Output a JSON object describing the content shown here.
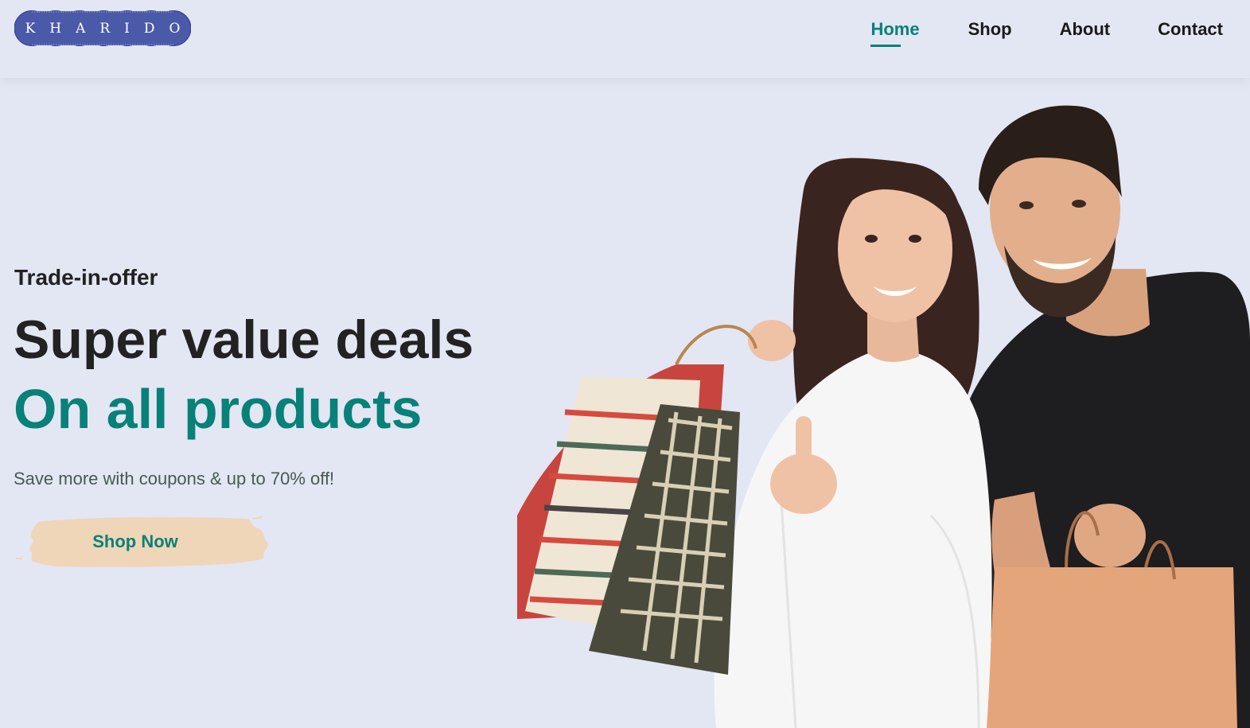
{
  "brand": {
    "logo_text": "KHARIDO",
    "logo_color": "#4a5aa8"
  },
  "nav": {
    "items": [
      {
        "label": "Home",
        "active": true
      },
      {
        "label": "Shop",
        "active": false
      },
      {
        "label": "About",
        "active": false
      },
      {
        "label": "Contact",
        "active": false
      }
    ]
  },
  "hero": {
    "eyebrow": "Trade-in-offer",
    "title": "Super value deals",
    "title_accent": "On all products",
    "description": "Save more with coupons & up to 70% off!",
    "cta_label": "Shop Now"
  },
  "colors": {
    "background": "#e3e6f3",
    "accent": "#088178",
    "text": "#222222",
    "button_brush": "#efd6b8"
  }
}
